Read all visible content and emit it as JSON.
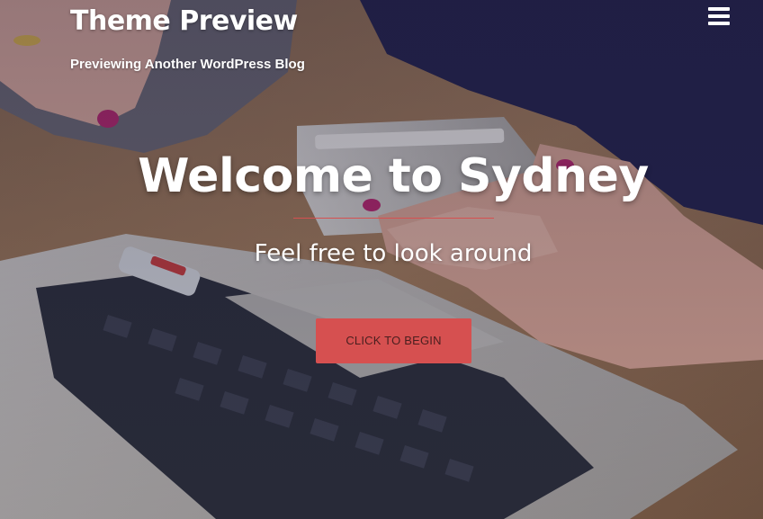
{
  "header": {
    "site_title": "Theme Preview",
    "site_description": "Previewing Another WordPress Blog",
    "menu_icon": "hamburger-menu-icon"
  },
  "hero": {
    "title": "Welcome to Sydney",
    "subtitle": "Feel free to look around",
    "button_label": "CLICK TO BEGIN",
    "background_image": "hands holding a smartphone over a laptop keyboard on a wooden desk"
  },
  "colors": {
    "accent": "#d65050",
    "text": "#ffffff"
  }
}
